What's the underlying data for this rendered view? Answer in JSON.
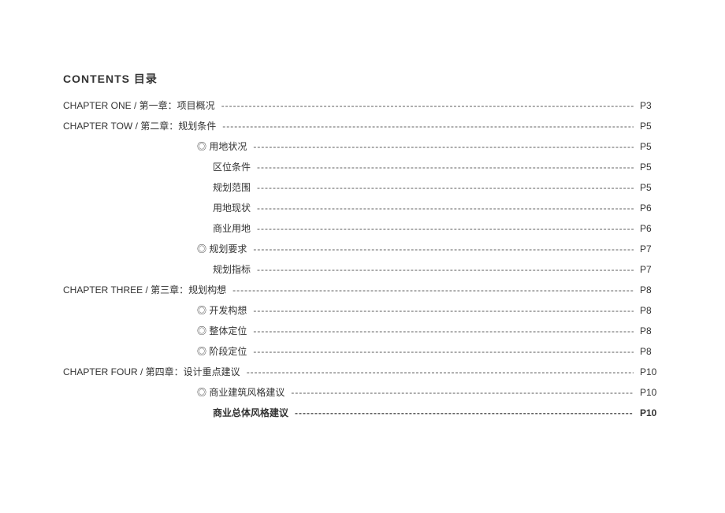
{
  "title": "CONTENTS 目录",
  "entries": [
    {
      "level": 0,
      "label": "CHAPTER ONE / 第一章：项目概况",
      "page": "P3",
      "bold": false
    },
    {
      "level": 0,
      "label": "CHAPTER TOW / 第二章：规划条件",
      "page": "P5",
      "bold": false
    },
    {
      "level": 1,
      "label": "◎ 用地状况",
      "page": "P5",
      "bold": false
    },
    {
      "level": 2,
      "label": "区位条件",
      "page": "P5",
      "bold": false
    },
    {
      "level": 2,
      "label": "规划范围",
      "page": "P5",
      "bold": false
    },
    {
      "level": 2,
      "label": "用地现状",
      "page": "P6",
      "bold": false
    },
    {
      "level": 2,
      "label": "商业用地",
      "page": "P6",
      "bold": false
    },
    {
      "level": 1,
      "label": "◎ 规划要求",
      "page": "P7",
      "bold": false
    },
    {
      "level": 2,
      "label": "规划指标",
      "page": "P7",
      "bold": false
    },
    {
      "level": 0,
      "label": "CHAPTER THREE / 第三章：规划构想",
      "page": "P8",
      "bold": false
    },
    {
      "level": 1,
      "label": "◎ 开发构想",
      "page": "P8",
      "bold": false
    },
    {
      "level": 1,
      "label": "◎ 整体定位",
      "page": "P8",
      "bold": false
    },
    {
      "level": 1,
      "label": "◎ 阶段定位",
      "page": "P8",
      "bold": false
    },
    {
      "level": 0,
      "label": "CHAPTER FOUR / 第四章：设计重点建议",
      "page": "P10",
      "bold": false
    },
    {
      "level": 1,
      "label": "◎ 商业建筑风格建议",
      "page": "P10",
      "bold": false
    },
    {
      "level": 2,
      "label": "商业总体风格建议",
      "page": "P10",
      "bold": true
    }
  ],
  "leader_char": "-"
}
